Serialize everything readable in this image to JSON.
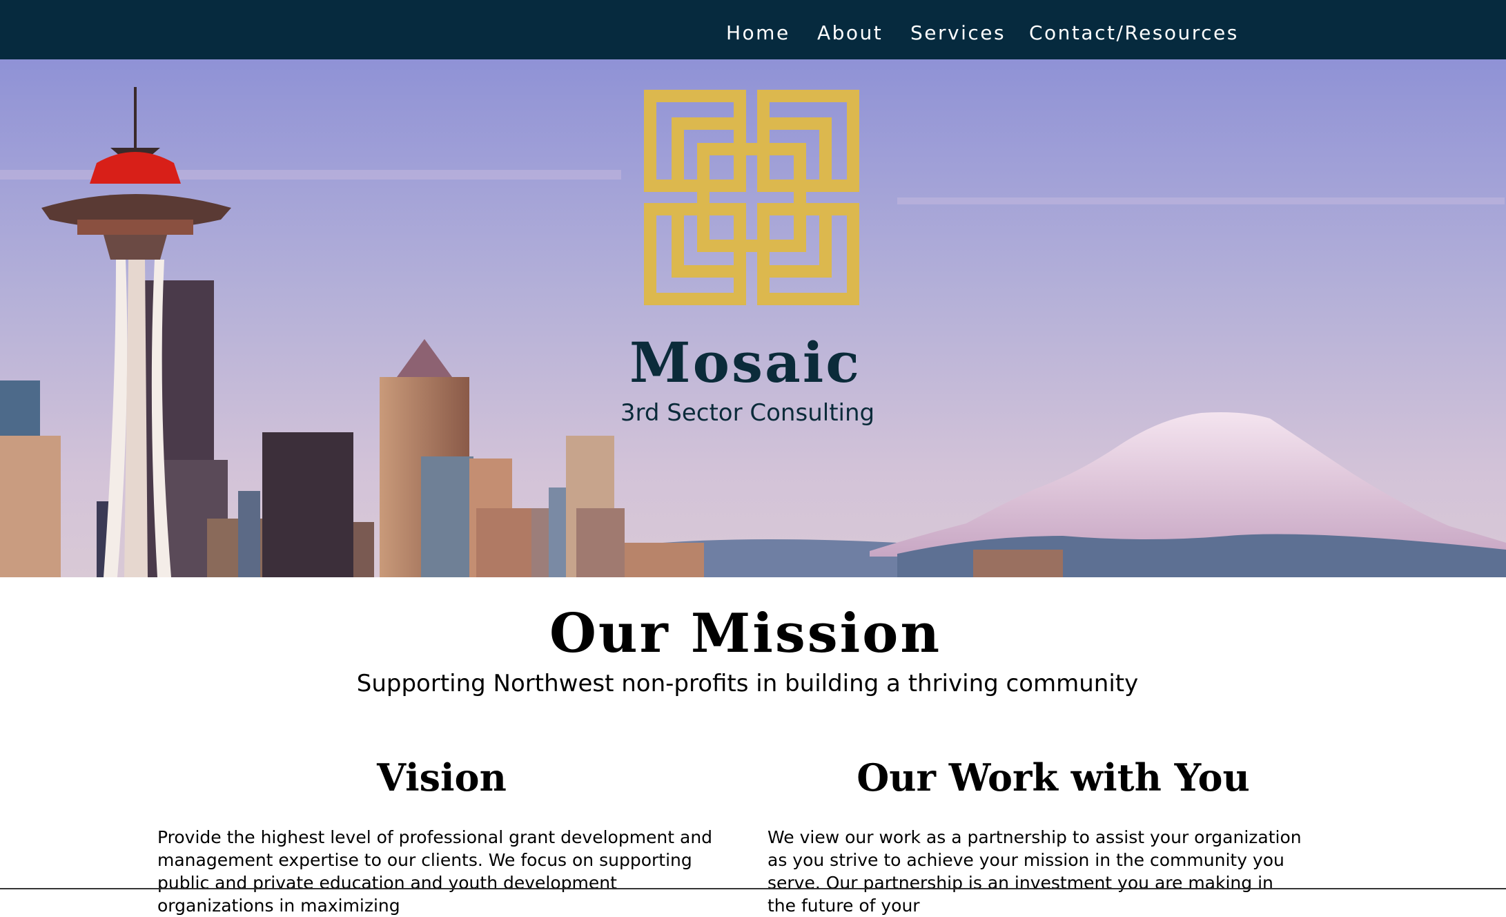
{
  "nav": {
    "items": [
      {
        "label": "Home"
      },
      {
        "label": "About"
      },
      {
        "label": "Services"
      },
      {
        "label": "Contact/Resources"
      }
    ]
  },
  "hero": {
    "brand_name": "Mosaic",
    "tagline": "3rd Sector Consulting",
    "logo_icon": "interlocking-squares-logo-icon"
  },
  "mission": {
    "title": "Our Mission",
    "subtitle": "Supporting Northwest non-profits in building a thriving community"
  },
  "columns": {
    "vision": {
      "heading": "Vision",
      "text": "Provide the highest level of professional grant development and management expertise to our clients. We focus on supporting public and private education and youth development organizations in maximizing"
    },
    "work": {
      "heading": "Our Work with You",
      "text": "We view our work as a partnership to assist your organization as you strive to achieve your mission in the community you serve. Our partnership is an investment you are making in the future of your"
    }
  },
  "colors": {
    "nav_bg": "#062a3e",
    "brand_text": "#0b2b3a",
    "logo_gold": "#dcb84e"
  }
}
